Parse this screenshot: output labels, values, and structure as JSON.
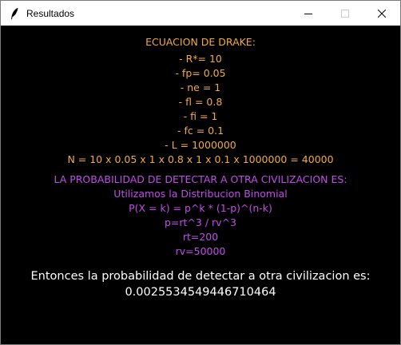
{
  "window": {
    "title": "Resultados",
    "icons": {
      "app": "feather-icon",
      "minimize": "minimize-icon",
      "maximize": "maximize-icon",
      "close": "close-icon"
    }
  },
  "drake": {
    "heading": "ECUACION DE DRAKE:",
    "params": [
      "- R*= 10",
      "- fp= 0.05",
      "- ne = 1",
      "- fl = 0.8",
      "- fi = 1",
      "- fc = 0.1",
      "- L = 1000000"
    ],
    "result": "N = 10 x 0.05 x 1 x 0.8 x 1 x 0.1 x 1000000 = 40000"
  },
  "probability": {
    "heading": "LA PROBABILIDAD DE DETECTAR A OTRA CIVILIZACION ES:",
    "lines": [
      "Utilizamos la Distribucion Binomial",
      "P(X = k) = p^k * (1-p)^(n-k)",
      "p=rt^3 / rv^3",
      "rt=200",
      "rv=50000"
    ]
  },
  "conclusion": {
    "text": "Entonces la probabilidad de detectar a otra civilizacion es:",
    "value": "0.0025534549446710464"
  },
  "colors": {
    "background": "#000000",
    "drake": "#f2ac3c",
    "probability": "#c04ee8",
    "conclusion": "#ffffff"
  }
}
